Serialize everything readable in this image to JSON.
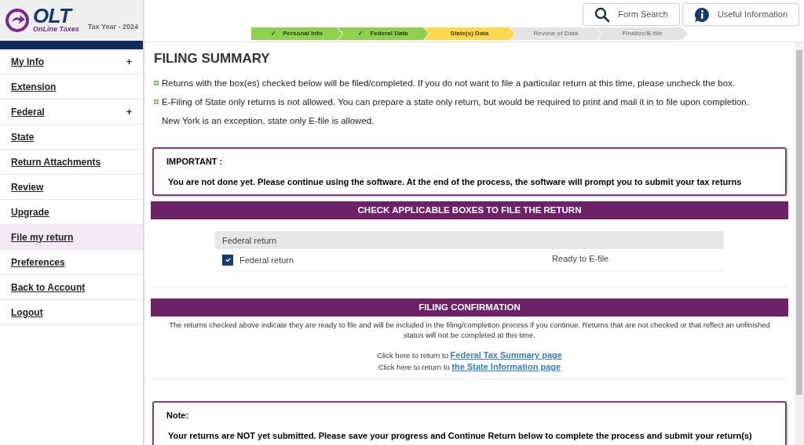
{
  "logo": {
    "mark": "OLT",
    "name": "OnLine Taxes",
    "tax_year": "Tax Year - 2024"
  },
  "header_buttons": [
    {
      "label": "Form Search",
      "kind": "search"
    },
    {
      "label": "Useful Information",
      "kind": "info"
    }
  ],
  "steps": [
    {
      "label": "Personal Info",
      "done": true,
      "selected": false,
      "check": "✓"
    },
    {
      "label": "Federal Data",
      "done": true,
      "selected": false,
      "check": "✓"
    },
    {
      "label": "State(s) Data",
      "done": false,
      "selected": true
    },
    {
      "label": "Review of Data",
      "done": false,
      "selected": false
    },
    {
      "label": "Finalize/E-file",
      "done": false,
      "selected": false
    }
  ],
  "sidebar": {
    "items": [
      {
        "label": "My Info",
        "expander": "+",
        "selected": false
      },
      {
        "label": "Extension",
        "selected": false
      },
      {
        "label": "Federal",
        "expander": "+",
        "selected": false
      },
      {
        "label": "State",
        "selected": false
      },
      {
        "label": "Return Attachments",
        "selected": false
      },
      {
        "label": "Review",
        "selected": false
      },
      {
        "label": "Upgrade",
        "selected": false
      },
      {
        "label": "File my return",
        "selected": true
      },
      {
        "label": "Preferences",
        "selected": false
      },
      {
        "label": "Back to Account",
        "selected": false
      },
      {
        "label": "Logout",
        "selected": false
      }
    ]
  },
  "page_title": "FILING SUMMARY",
  "bullets": [
    {
      "text": "Returns with the box(es) checked below will be filed/completed. If you do not want to file a particular return at this time, please uncheck the box."
    },
    {
      "text": "E-Filing of State only returns is not allowed. You can prepare a state only return, but would be required to print and mail it in to file upon completion.",
      "note": "New York is an exception, state only E-file is allowed."
    }
  ],
  "important": {
    "title": "IMPORTANT :",
    "text": "You are not done yet. Please continue using the software. At the end of the process, the software will prompt you to submit your tax returns"
  },
  "check_section": {
    "title": "CHECK APPLICABLE BOXES TO FILE THE RETURN",
    "group_header": "Federal return",
    "returns": [
      {
        "label": "Federal return",
        "checked": true,
        "status": "Ready to E-file"
      }
    ]
  },
  "confirmation": {
    "title": "FILING CONFIRMATION",
    "text": "The returns checked above indicate they are ready to file and will be included in the filing/completion process if you continue. Returns that are not checked or that reflect an unfinished status will not be completed at this time.",
    "links": [
      {
        "prefix": "Click here to return to",
        "link": "Federal Tax Summary page"
      },
      {
        "prefix": "Click here to return to",
        "link": "the State Information page"
      }
    ]
  },
  "note": {
    "title": "Note:",
    "text": "Your returns are NOT yet submitted. Please save your progress and Continue Return below to complete the process and submit your return(s)"
  }
}
